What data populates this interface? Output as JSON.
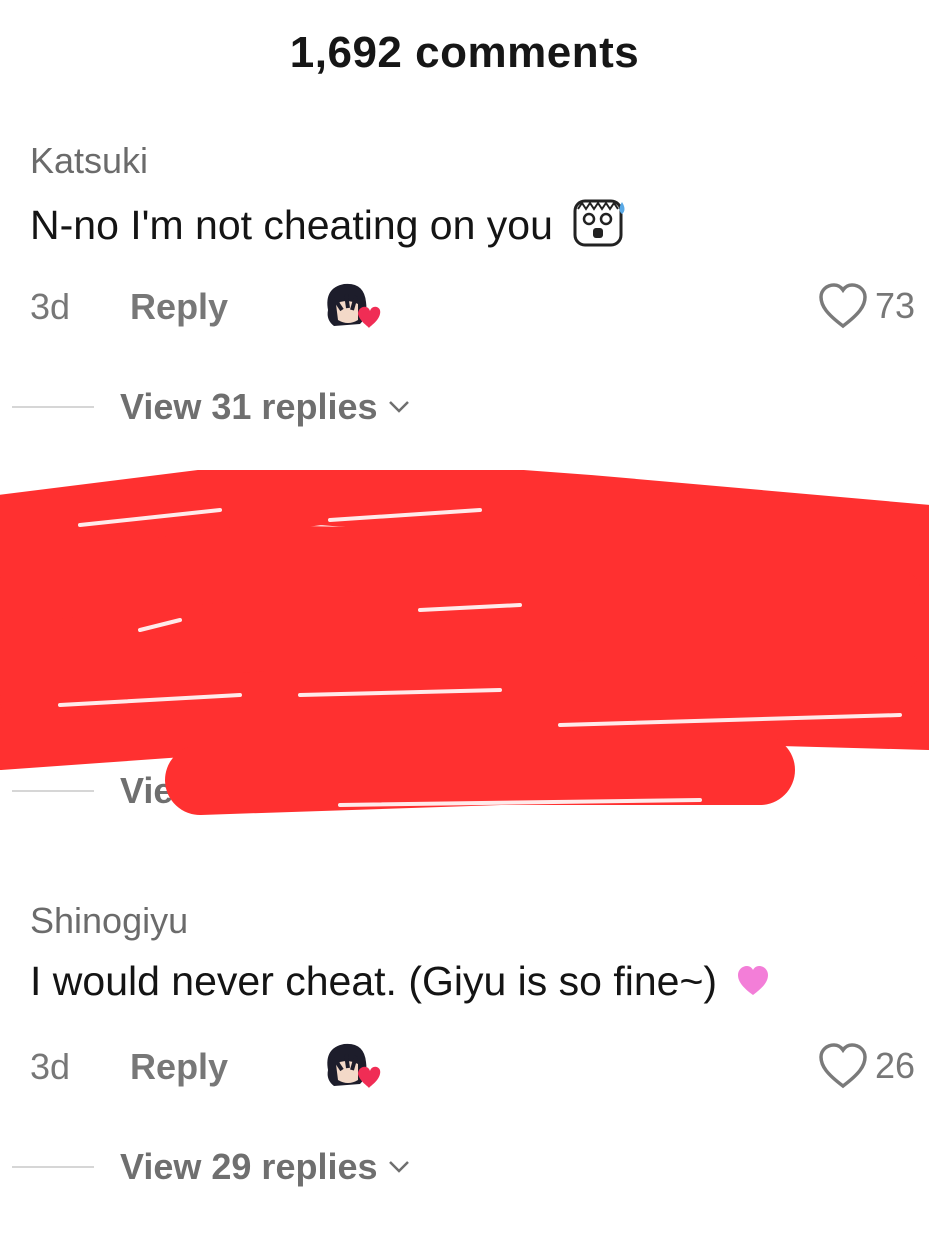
{
  "header": {
    "comment_count": "1,692 comments"
  },
  "comments": [
    {
      "username": "Katsuki",
      "text": "N-no I'm not cheating on you",
      "time": "3d",
      "reply_label": "Reply",
      "likes": "73",
      "view_replies": "View 31 replies",
      "emoji": "screaming-face-sticker-icon"
    },
    {
      "partial_view_replies": "Vie"
    },
    {
      "username": "Shinogiyu",
      "text": "I would never cheat. (Giyu is so fine~)",
      "time": "3d",
      "reply_label": "Reply",
      "likes": "26",
      "view_replies": "View 29 replies",
      "emoji": "pink-heart-icon"
    }
  ],
  "colors": {
    "redaction": "#ff3030",
    "muted": "#777777"
  }
}
